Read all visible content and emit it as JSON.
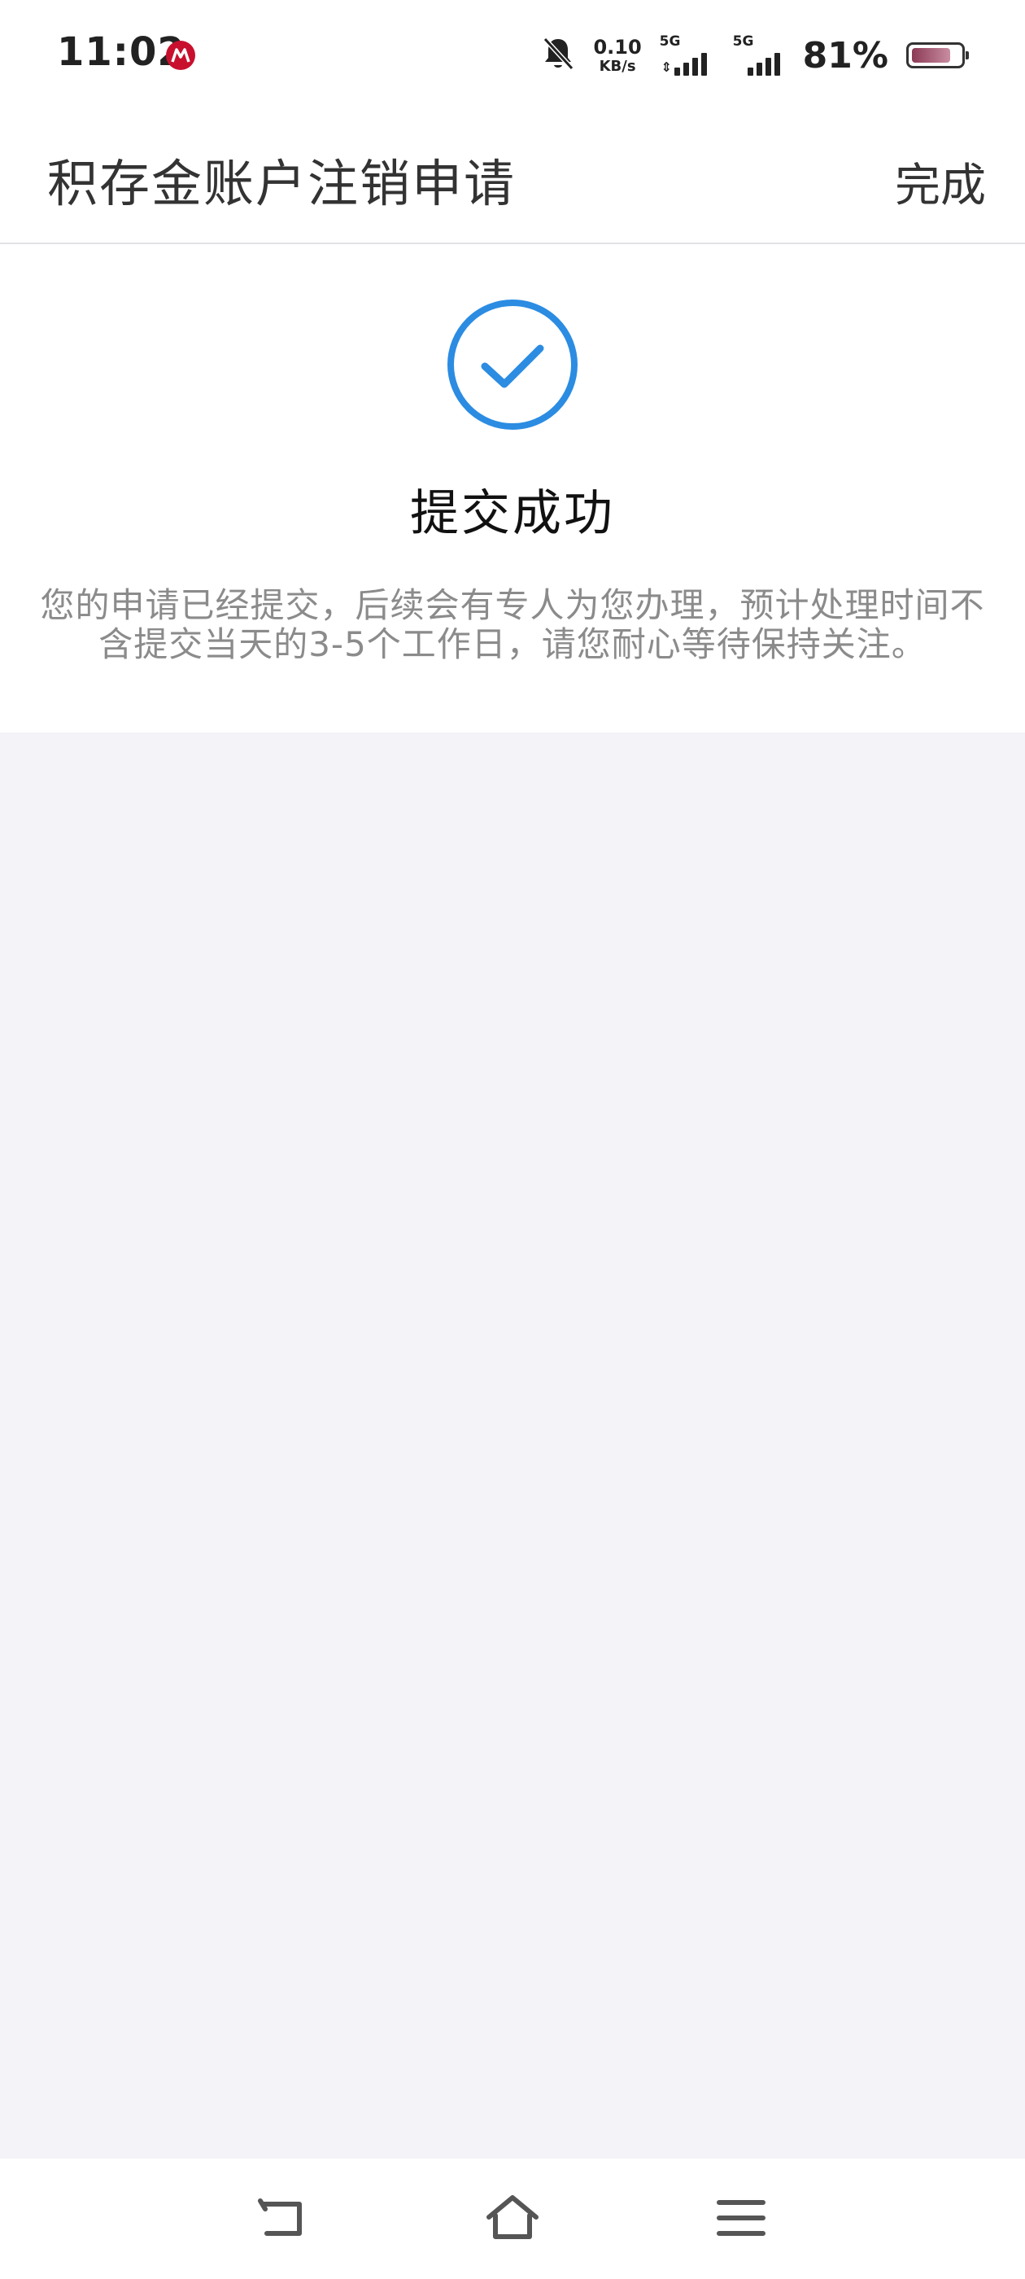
{
  "status_bar": {
    "time": "11:02",
    "net_speed_value": "0.10",
    "net_speed_unit": "KB/s",
    "sim1_label": "5G",
    "sim2_label": "5G",
    "battery_percent": "81%",
    "battery_level": 0.81,
    "icons": [
      "app-notification-icon",
      "bell-muted-icon",
      "signal-icon",
      "battery-icon"
    ],
    "app_icon_color": "#c8102e"
  },
  "header": {
    "title": "积存金账户注销申请",
    "done_label": "完成"
  },
  "result": {
    "icon": "check-circle-icon",
    "icon_color": "#2b8ce2",
    "title": "提交成功",
    "description_line1": "您的申请已经提交，后续会有专人为您办理，预计处理时间不",
    "description_line2": "含提交当天的3-5个工作日，请您耐心等待保持关注。"
  },
  "nav_bar": {
    "icons": [
      "back-icon",
      "home-icon",
      "menu-icon"
    ]
  }
}
